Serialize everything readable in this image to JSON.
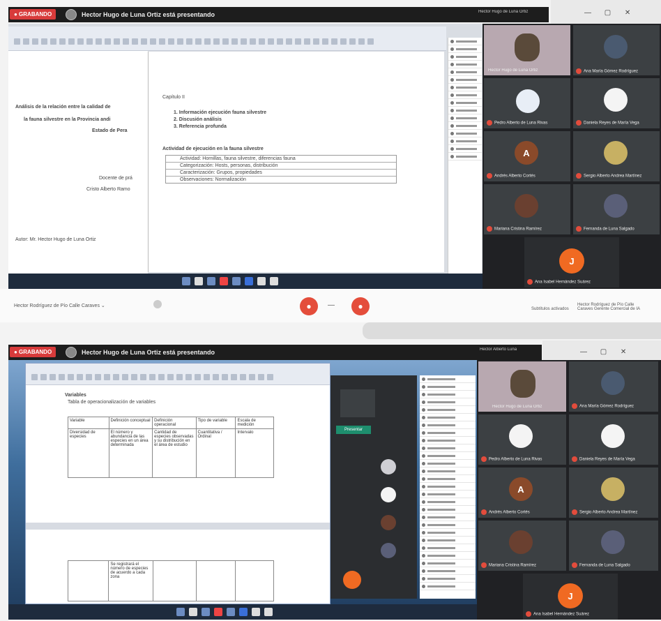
{
  "top": {
    "recording_label": "● GRABANDO",
    "presenter_label": "Hector Hugo de Luna Ortiz está presentando",
    "pinned_name": "Hector Hugo de Luna Ortiz",
    "window_controls": [
      "—",
      "▢",
      "✕"
    ],
    "doc_left_lines": [
      "Análisis de la relación entre la calidad de",
      "la fauna silvestre en la Provincia andi",
      "Estado de Pera"
    ],
    "doc_left_sub": [
      "Docente de prá",
      "Cristo Alberto Ramo"
    ],
    "doc_left_author": "Autor: Mr. Hector Hugo de Luna Ortiz",
    "doc_heading": "Capítulo II",
    "doc_items": [
      "1. Información ejecución fauna silvestre",
      "2. Discusión análisis",
      "3. Referencia profunda"
    ],
    "doc_table_title": "Actividad de ejecución en la fauna silvestre",
    "doc_table_rows": [
      "Actividad: Hornillas, fauna silvestre, diferencias fauna",
      "Categorización: Hosts, personas, distribución",
      "Caracterización: Grupos, propiedades",
      "Observaciones: Normalización"
    ],
    "bottom_left_text": "Hector Rodríguez de Pío Calle Caraves  ⌄",
    "bottom_right_a": "Subtítulos activados",
    "bottom_right_b": "Hector Rodríguez de Pío Calle Caraves Gerente Comercial de IA",
    "participants": [
      {
        "name": "Hector Hugo de Luna Ortiz",
        "color": "#5a4a3a",
        "letter": ""
      },
      {
        "name": "Ana María Gómez Rodríguez",
        "color": "#4a5a70",
        "letter": ""
      },
      {
        "name": "Pedro Alberto de Luna Rivas",
        "color": "#e8eef6",
        "letter": ""
      },
      {
        "name": "Daniela Reyes de María Vega",
        "color": "#f4f4f4",
        "letter": ""
      },
      {
        "name": "Andrés Alberto Cortés",
        "color": "#8a4a2a",
        "letter": "A"
      },
      {
        "name": "Sergio Alberto Andrea Martínez",
        "color": "#c7b063",
        "letter": ""
      },
      {
        "name": "Mariana Cristina Ramírez",
        "color": "#6a4030",
        "letter": ""
      },
      {
        "name": "Fernanda de Luna Salgado",
        "color": "#5a5f78",
        "letter": ""
      },
      {
        "name": "Ana Isabel Hernández Suárez",
        "color": "#f06a22",
        "letter": "J"
      }
    ]
  },
  "bottom": {
    "recording_label": "● GRABANDO",
    "presenter_label": "Hector Hugo de Luna Ortiz está presentando",
    "pinned_name": "Hector Alberto Luna",
    "heading": "Variables",
    "subheading": "Tabla de operacionalización de variables",
    "table_headers": [
      "Variable",
      "Definición conceptual",
      "Definición operacional",
      "Tipo de variable",
      "Escala de medición"
    ],
    "table_row": [
      "Diversidad de especies",
      "El número y abundancia de las especies en un área determinada",
      "Cantidad de especies observadas y su distribución en el área de estudio",
      "Cuantitativa / Ordinal",
      "Intervalo"
    ],
    "lower_cell": "Se registrará el número de especies de acuerdo a cada zona",
    "green_btn": "Presentar",
    "participants": [
      {
        "name": "Hector Hugo de Luna Ortiz",
        "color": "#5a4a3a",
        "letter": ""
      },
      {
        "name": "Ana María Gómez Rodríguez",
        "color": "#4a5a70",
        "letter": ""
      },
      {
        "name": "Pedro Alberto de Luna Rivas",
        "color": "#f4f4f4",
        "letter": ""
      },
      {
        "name": "Daniela Reyes de María Vega",
        "color": "#f4f4f4",
        "letter": ""
      },
      {
        "name": "Andrés Alberto Cortés",
        "color": "#8a4a2a",
        "letter": "A"
      },
      {
        "name": "Sergio Alberto Andrea Martínez",
        "color": "#c7b063",
        "letter": ""
      },
      {
        "name": "Mariana Cristina Ramírez",
        "color": "#6a4030",
        "letter": ""
      },
      {
        "name": "Fernanda de Luna Salgado",
        "color": "#5a5f78",
        "letter": ""
      },
      {
        "name": "Ana Isabel Hernández Suárez",
        "color": "#f06a22",
        "letter": "J"
      }
    ]
  }
}
